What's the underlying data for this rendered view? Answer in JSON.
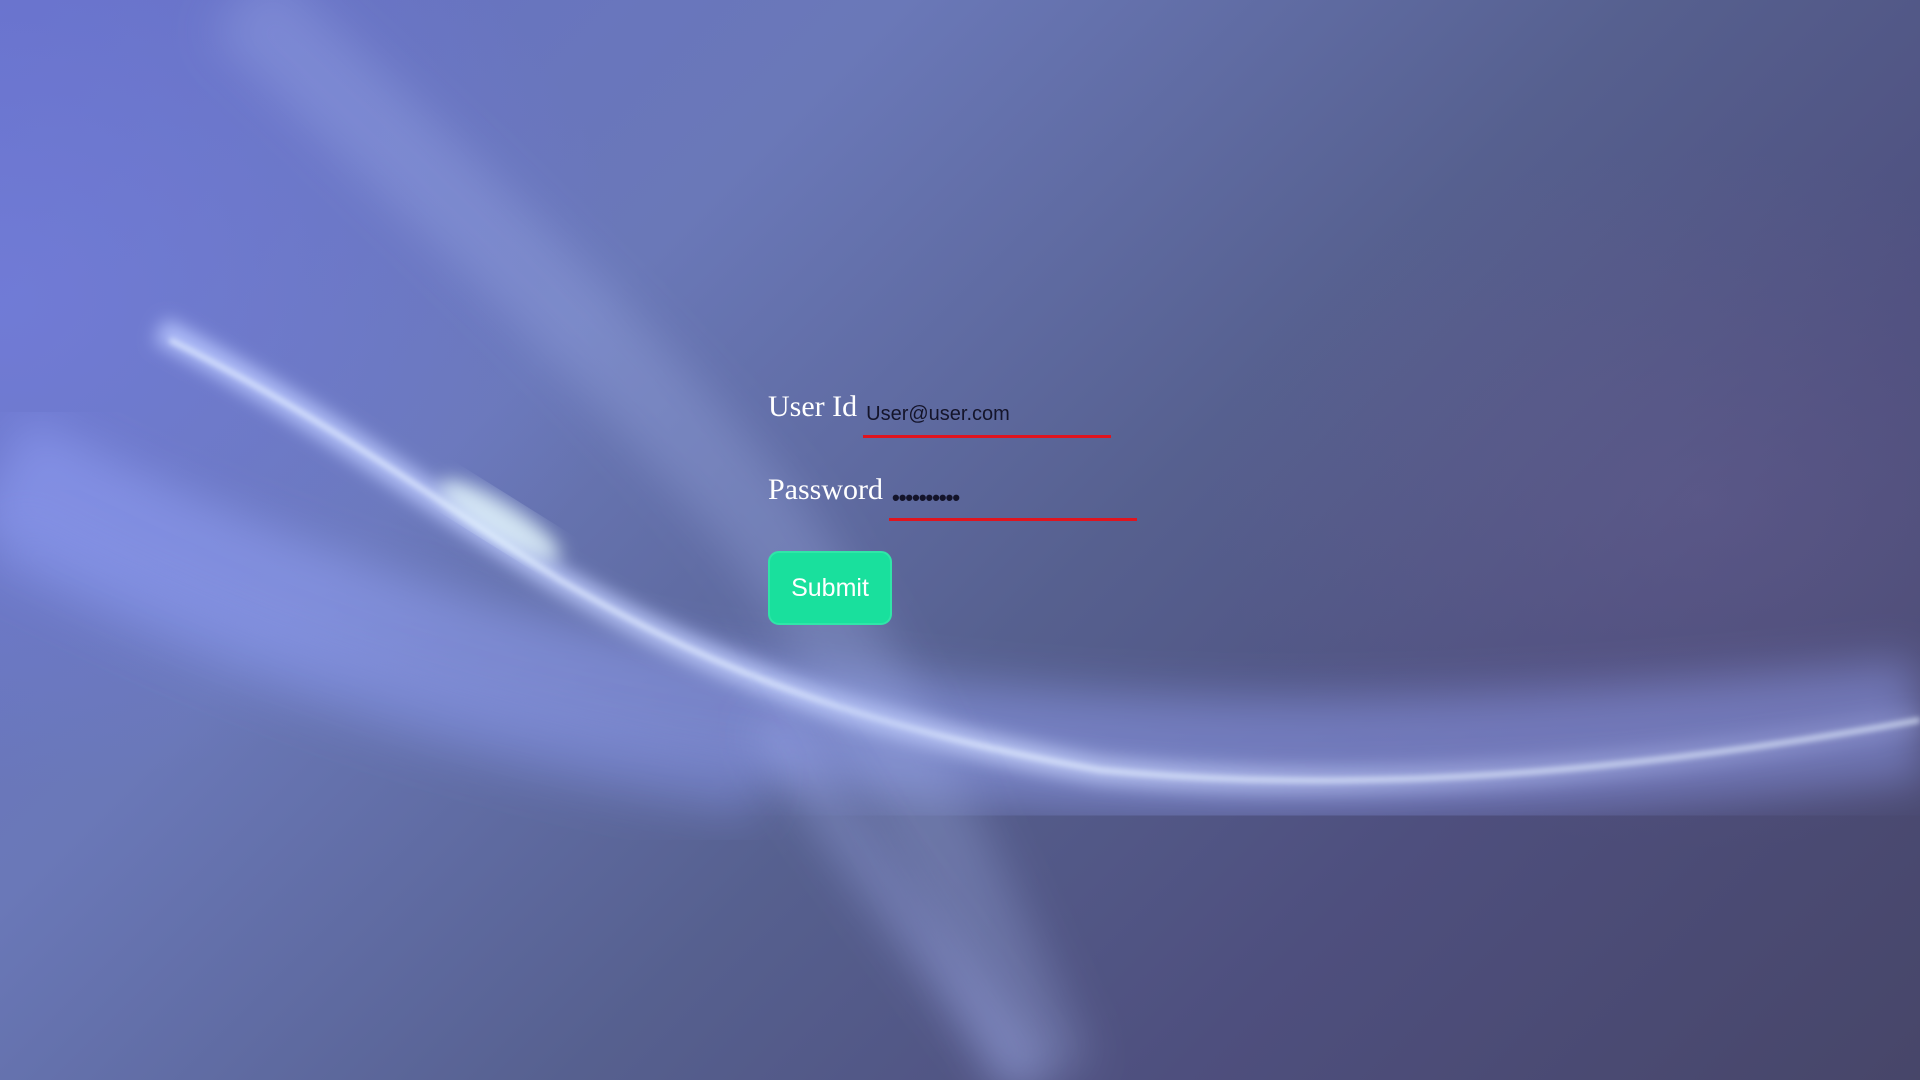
{
  "login": {
    "user_id_label": "User Id",
    "user_id_value": "User@user.com",
    "password_label": "Password",
    "password_value": "••••••••••",
    "submit_label": "Submit"
  },
  "colors": {
    "input_underline": "#e0141e",
    "submit_background": "#19e09d",
    "label_text": "#ffffff"
  }
}
